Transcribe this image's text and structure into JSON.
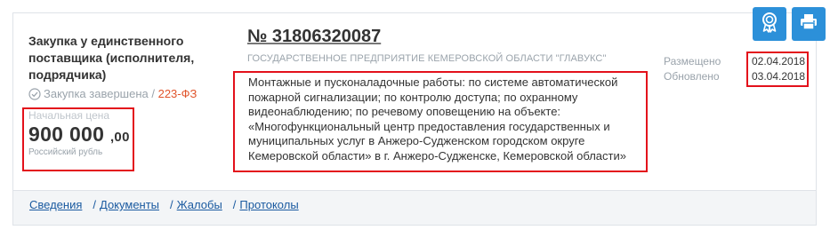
{
  "purchase": {
    "type": "Закупка у единственного поставщика (исполнителя, подрядчика)",
    "status": "Закупка завершена",
    "status_separator": " / ",
    "law": "223-ФЗ",
    "price_label": "Начальная цена",
    "price_main": "900 000",
    "price_cents": ",00",
    "currency": "Российский рубль",
    "number": "№ 31806320087",
    "organization": "ГОСУДАРСТВЕННОЕ ПРЕДПРИЯТИЕ КЕМЕРОВСКОЙ ОБЛАСТИ \"ГЛАВУКС\"",
    "description": "Монтажные и пусконаладочные работы: по системе автоматической пожарной сигнализации; по контролю доступа; по охранному видеонаблюдению; по речевому оповещению на объекте: «Многофункциональный центр предоставления государственных и муниципальных услуг в Анжеро-Судженском городском округе Кемеровской области» в г. Анжеро-Судженске, Кемеровской области»",
    "posted_label": "Размещено",
    "posted_date": "02.04.2018",
    "updated_label": "Обновлено",
    "updated_date": "03.04.2018"
  },
  "tabs": [
    {
      "label": "Сведения"
    },
    {
      "label": "Документы"
    },
    {
      "label": "Жалобы"
    },
    {
      "label": "Протоколы"
    }
  ],
  "tab_separator": "/",
  "icons": {
    "award": "award-icon",
    "print": "print-icon",
    "check": "check-circle-icon"
  },
  "colors": {
    "accent": "#2c90d9",
    "highlight_box": "#e3111b",
    "law": "#e0542b",
    "link": "#1a5aa0"
  }
}
